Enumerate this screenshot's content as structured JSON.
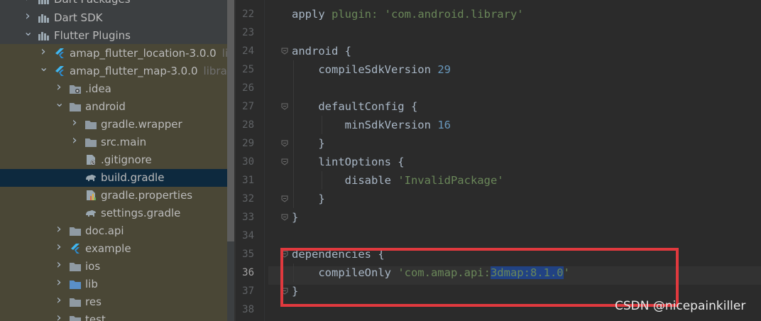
{
  "project_tree": {
    "rows": [
      {
        "label": "Dart Packages",
        "hint": "",
        "icon": "library-icon",
        "expanded": false
      },
      {
        "label": "Dart SDK",
        "hint": "",
        "icon": "library-icon",
        "expanded": false
      },
      {
        "label": "Flutter Plugins",
        "hint": "",
        "icon": "library-icon",
        "expanded": true
      },
      {
        "label": "amap_flutter_location-3.0.0",
        "hint": "libra",
        "icon": "flutter-icon",
        "expanded": false
      },
      {
        "label": "amap_flutter_map-3.0.0",
        "hint": "library r",
        "icon": "flutter-icon",
        "expanded": true
      },
      {
        "label": ".idea",
        "hint": "",
        "icon": "folder-idea-icon",
        "expanded": false
      },
      {
        "label": "android",
        "hint": "",
        "icon": "folder-icon",
        "expanded": true
      },
      {
        "label": "gradle.wrapper",
        "hint": "",
        "icon": "folder-icon",
        "expanded": false
      },
      {
        "label": "src.main",
        "hint": "",
        "icon": "folder-icon",
        "expanded": false
      },
      {
        "label": ".gitignore",
        "hint": "",
        "icon": "gitignore-file-icon",
        "expanded": null
      },
      {
        "label": "build.gradle",
        "hint": "",
        "icon": "gradle-elephant-icon",
        "expanded": null
      },
      {
        "label": "gradle.properties",
        "hint": "",
        "icon": "properties-file-icon",
        "expanded": null
      },
      {
        "label": "settings.gradle",
        "hint": "",
        "icon": "gradle-elephant-icon",
        "expanded": null
      },
      {
        "label": "doc.api",
        "hint": "",
        "icon": "folder-icon",
        "expanded": false
      },
      {
        "label": "example",
        "hint": "",
        "icon": "flutter-icon",
        "expanded": false
      },
      {
        "label": "ios",
        "hint": "",
        "icon": "folder-icon",
        "expanded": false
      },
      {
        "label": "lib",
        "hint": "",
        "icon": "folder-blue-icon",
        "expanded": false
      },
      {
        "label": "res",
        "hint": "",
        "icon": "folder-icon",
        "expanded": false
      },
      {
        "label": "test",
        "hint": "",
        "icon": "folder-icon",
        "expanded": false
      }
    ],
    "selected_label": "build.gradle"
  },
  "editor": {
    "current_line": "36",
    "lines": [
      {
        "num": "22",
        "code": [
          {
            "t": "apply "
          },
          {
            "t": "plugin: ",
            "c": "str"
          },
          {
            "t": "'com.android.library'",
            "c": "str"
          }
        ]
      },
      {
        "num": "23",
        "code": []
      },
      {
        "num": "24",
        "code": [
          {
            "t": "android {"
          }
        ]
      },
      {
        "num": "25",
        "code": [
          {
            "t": "    compileSdkVersion "
          },
          {
            "t": "29",
            "c": "num"
          }
        ]
      },
      {
        "num": "26",
        "code": []
      },
      {
        "num": "27",
        "code": [
          {
            "t": "    defaultConfig {"
          }
        ]
      },
      {
        "num": "28",
        "code": [
          {
            "t": "        minSdkVersion "
          },
          {
            "t": "16",
            "c": "num"
          }
        ]
      },
      {
        "num": "29",
        "code": [
          {
            "t": "    }"
          }
        ]
      },
      {
        "num": "30",
        "code": [
          {
            "t": "    lintOptions {"
          }
        ]
      },
      {
        "num": "31",
        "code": [
          {
            "t": "        disable "
          },
          {
            "t": "'InvalidPackage'",
            "c": "str"
          }
        ]
      },
      {
        "num": "32",
        "code": [
          {
            "t": "    }"
          }
        ]
      },
      {
        "num": "33",
        "code": [
          {
            "t": "}"
          }
        ]
      },
      {
        "num": "34",
        "code": []
      },
      {
        "num": "35",
        "code": [
          {
            "t": "dependencies {"
          }
        ]
      },
      {
        "num": "36",
        "code": [
          {
            "t": "    compileOnly "
          },
          {
            "t": "'com.amap.api:",
            "c": "str"
          },
          {
            "t": "3dmap:8.1.0",
            "c": "str hl"
          },
          {
            "t": "'",
            "c": "str"
          }
        ]
      },
      {
        "num": "37",
        "code": [
          {
            "t": "}"
          }
        ]
      },
      {
        "num": "38",
        "code": []
      }
    ]
  },
  "watermark": "CSDN @nicepainkiller",
  "colors": {
    "annotation_box": "#e0393e",
    "selection": "#214283",
    "string": "#6a8759",
    "number": "#6897bb"
  }
}
